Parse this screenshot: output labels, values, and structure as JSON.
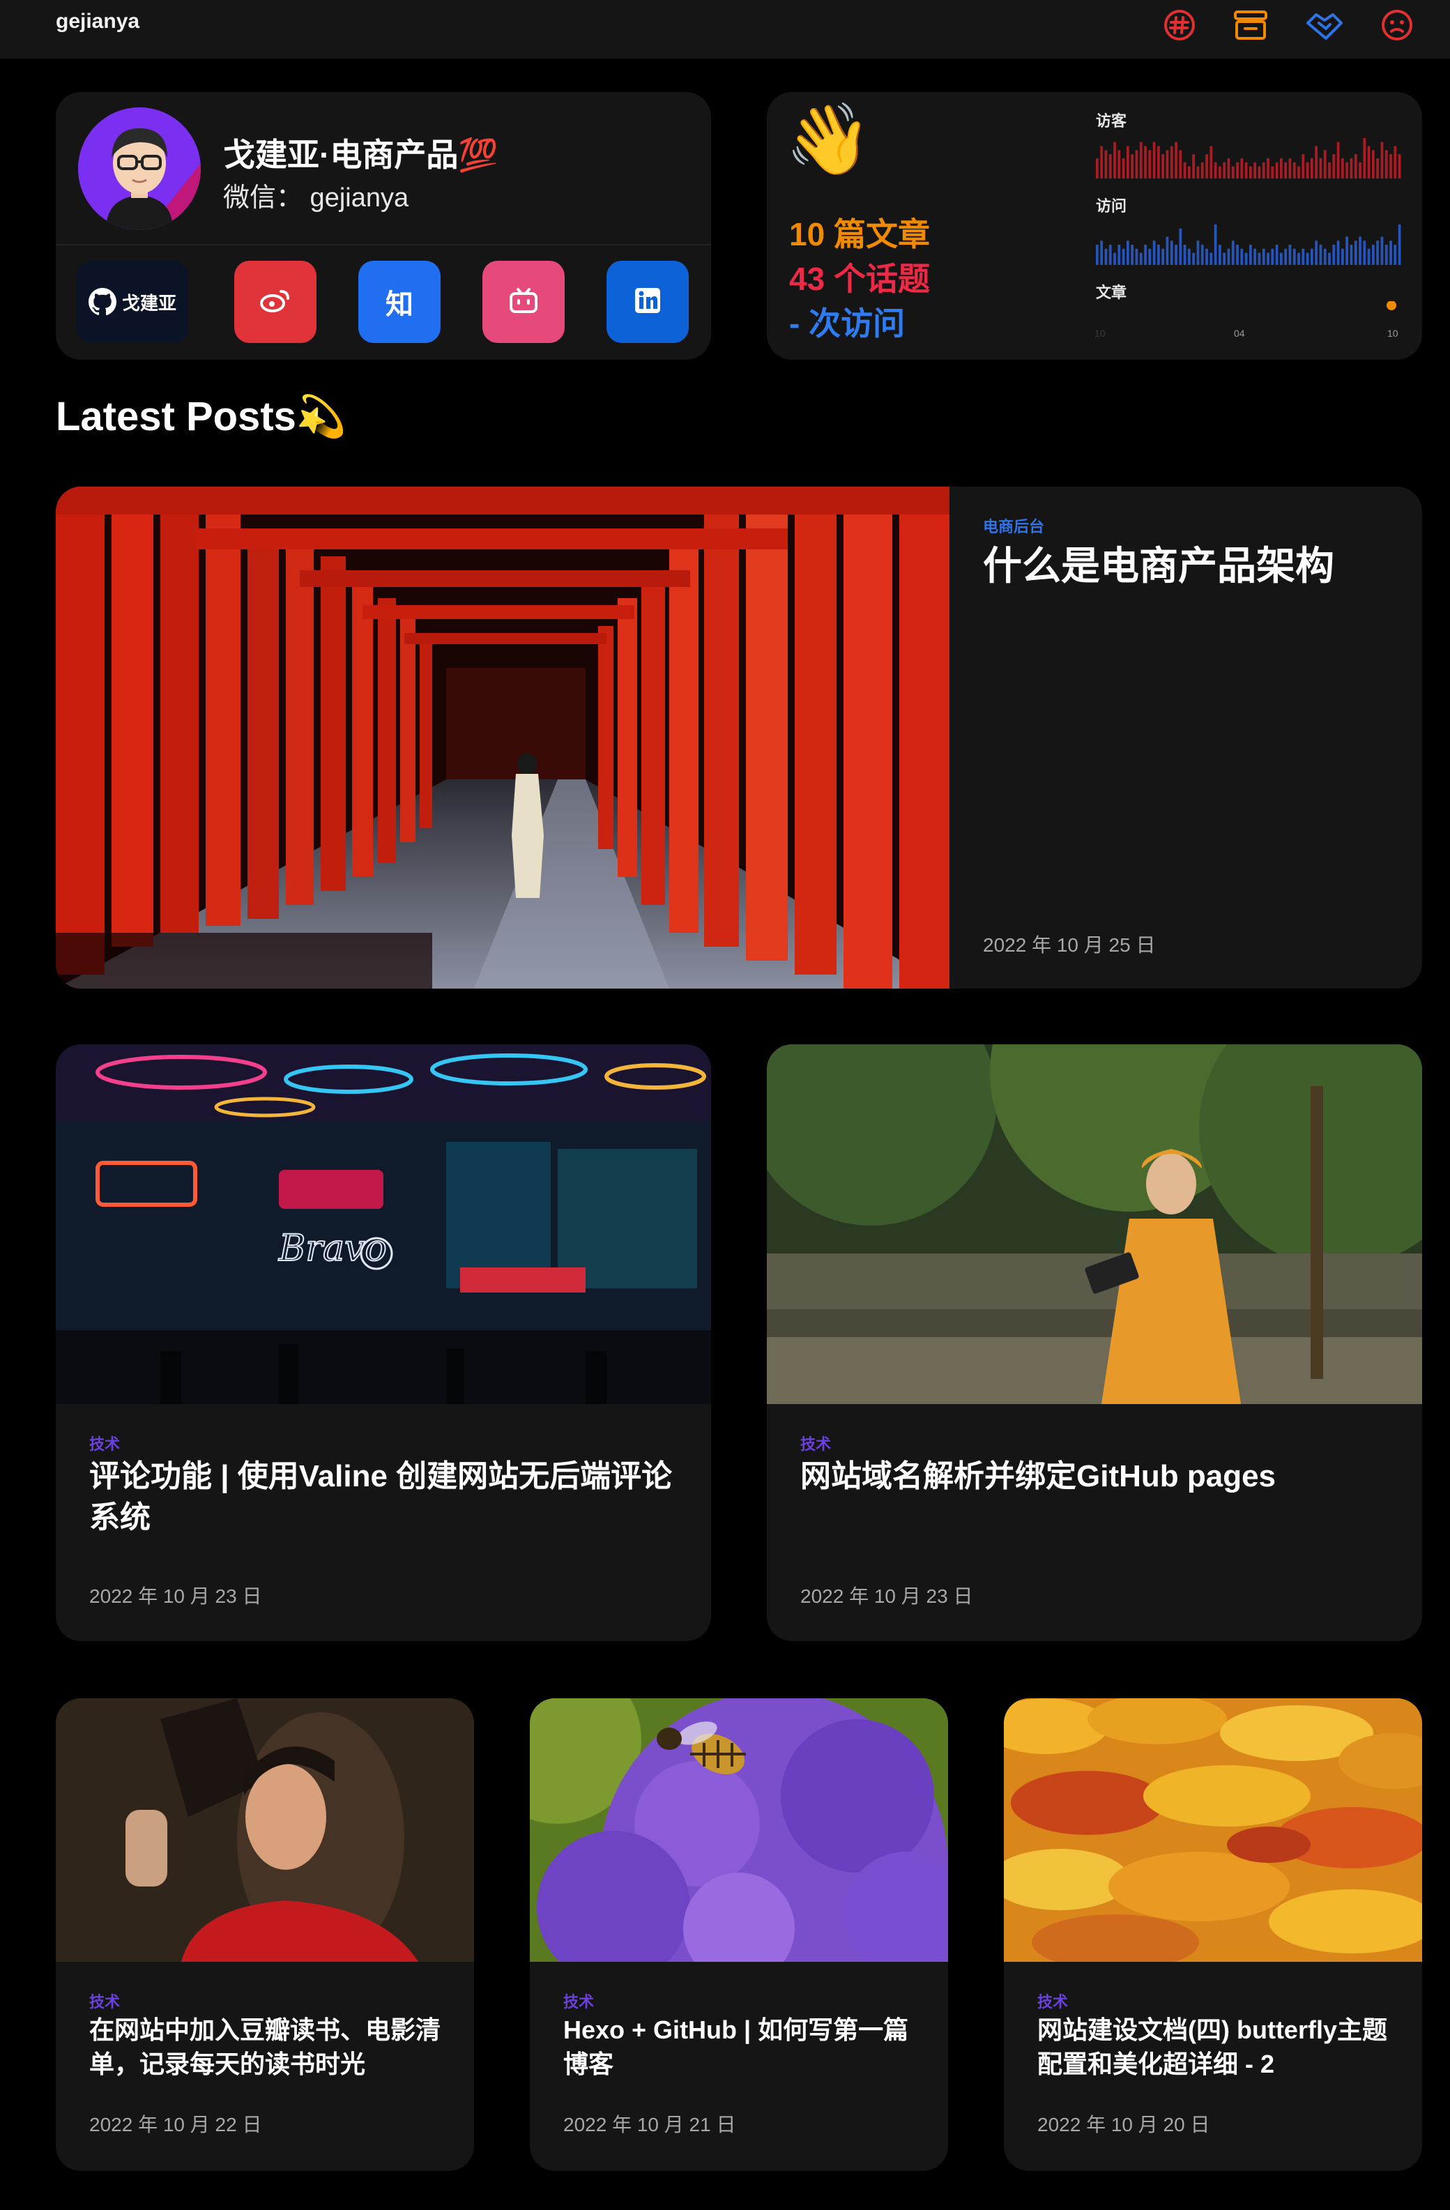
{
  "header": {
    "site_name": "gejianya",
    "icons": [
      {
        "name": "hashtag-icon",
        "color": "#e0302f"
      },
      {
        "name": "archive-icon",
        "color": "#f08a00"
      },
      {
        "name": "handshake-icon",
        "color": "#2f74e6"
      },
      {
        "name": "face-icon",
        "color": "#e0302f"
      }
    ]
  },
  "profile": {
    "name": "戈建亚·电商产品💯",
    "wechat": "微信： gejianya",
    "social": [
      {
        "name": "github",
        "label": "戈建亚",
        "color": "#0b1326"
      },
      {
        "name": "weibo",
        "label": "",
        "color": "#e0343a"
      },
      {
        "name": "zhihu",
        "label": "知",
        "color": "#1f6ff0"
      },
      {
        "name": "bilibili",
        "label": "",
        "color": "#e64a7a"
      },
      {
        "name": "linkedin",
        "label": "",
        "color": "#0d62d8"
      }
    ]
  },
  "stats": {
    "wave": "👋",
    "articles": "10 篇文章",
    "topics": "43 个话题",
    "visits": "- 次访问",
    "colors": {
      "articles": "#f08a00",
      "topics": "#ec2a46",
      "visits": "#2f7cf0"
    }
  },
  "chart_data": [
    {
      "type": "bar",
      "title": "访客",
      "color": "#a81d24",
      "values": [
        5,
        8,
        7,
        6,
        9,
        7,
        5,
        8,
        6,
        7,
        9,
        8,
        7,
        9,
        8,
        6,
        7,
        8,
        9,
        7,
        4,
        3,
        6,
        3,
        4,
        6,
        8,
        4,
        3,
        4,
        5,
        3,
        4,
        5,
        4,
        3,
        4,
        3,
        4,
        5,
        3,
        4,
        5,
        4,
        5,
        4,
        3,
        6,
        4,
        5,
        8,
        5,
        7,
        4,
        6,
        9,
        5,
        4,
        5,
        6,
        4,
        10,
        8,
        7,
        5,
        9,
        7,
        6,
        8,
        6
      ]
    },
    {
      "type": "bar",
      "title": "访问",
      "color": "#2754b8",
      "values": [
        5,
        6,
        4,
        5,
        3,
        5,
        4,
        6,
        5,
        4,
        3,
        5,
        4,
        6,
        5,
        4,
        7,
        6,
        5,
        9,
        5,
        4,
        3,
        6,
        5,
        4,
        3,
        10,
        5,
        3,
        4,
        6,
        5,
        4,
        3,
        5,
        4,
        3,
        4,
        3,
        4,
        5,
        3,
        4,
        5,
        4,
        3,
        4,
        3,
        4,
        6,
        5,
        4,
        3,
        5,
        6,
        4,
        7,
        5,
        6,
        7,
        6,
        4,
        5,
        6,
        7,
        5,
        6,
        5,
        10
      ]
    },
    {
      "type": "scatter",
      "title": "文章",
      "color": "#f08a00",
      "x_ticks": [
        "10",
        "04",
        "10"
      ],
      "points": [
        {
          "x": 1.0,
          "y": 1
        }
      ]
    }
  ],
  "section_title": "Latest Posts💫",
  "posts": [
    {
      "category": "电商后台",
      "title": "什么是电商产品架构",
      "date": "2022 年 10 月 25 日",
      "cat_color": "#2f74e6",
      "image": "torii-gates"
    },
    {
      "category": "技术",
      "title": "评论功能 | 使用Valine 创建网站无后端评论系统",
      "date": "2022 年 10 月 23 日",
      "cat_color": "#6b3fe0",
      "image": "neon-street"
    },
    {
      "category": "技术",
      "title": "网站域名解析并绑定GitHub pages",
      "date": "2022 年 10 月 23 日",
      "cat_color": "#6b3fe0",
      "image": "woman-in-park"
    },
    {
      "category": "技术",
      "title": "在网站中加入豆瓣读书、电影清单，记录每天的读书时光",
      "date": "2022 年 10 月 22 日",
      "cat_color": "#6b3fe0",
      "image": "woman-with-book"
    },
    {
      "category": "技术",
      "title": "Hexo + GitHub | 如何写第一篇博客",
      "date": "2022 年 10 月 21 日",
      "cat_color": "#6b3fe0",
      "image": "bee-on-flowers"
    },
    {
      "category": "技术",
      "title": "网站建设文档(四) butterfly主题配置和美化超详细 - 2",
      "date": "2022 年 10 月 20 日",
      "cat_color": "#6b3fe0",
      "image": "autumn-leaves"
    }
  ]
}
